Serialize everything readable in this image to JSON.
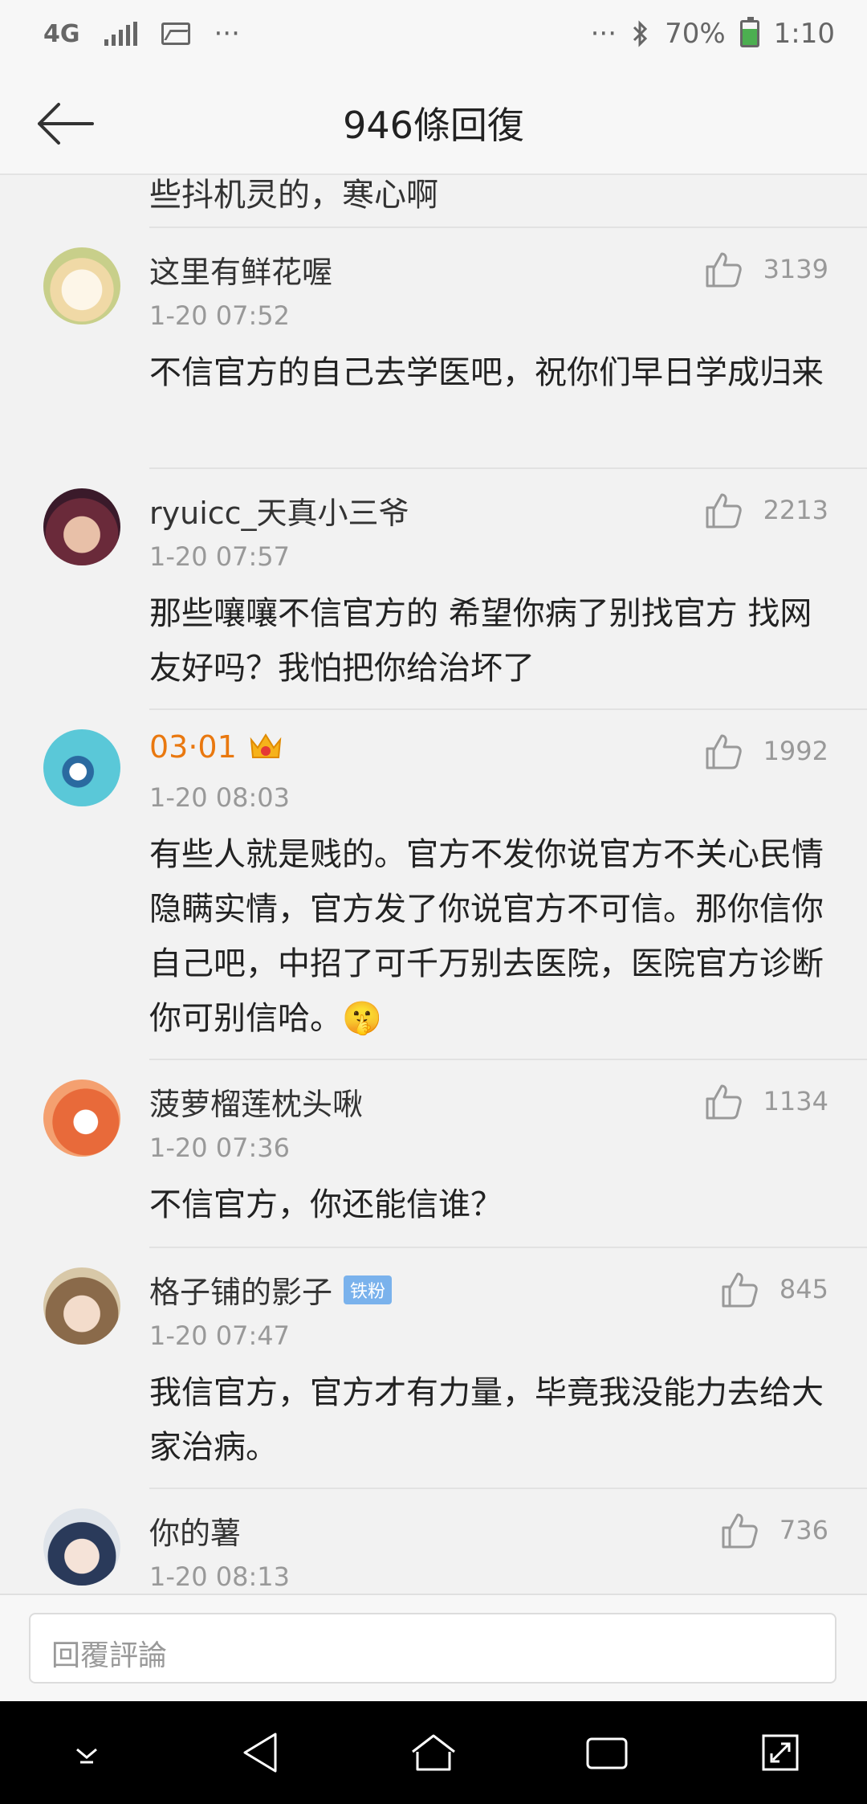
{
  "status_bar": {
    "network": "4G",
    "overflow": "···",
    "right_overflow": "···",
    "battery_percent": "70%",
    "time": "1:10"
  },
  "header": {
    "title": "946條回復",
    "back_icon": "arrow-left-icon"
  },
  "partial_comment_text": "些抖机灵的，寒心啊",
  "comments": [
    {
      "username": "这里有鲜花喔",
      "time": "1-20 07:52",
      "likes": "3139",
      "text": "不信官方的自己去学医吧，祝你们早日学成归来"
    },
    {
      "username": "ryuicc_天真小三爷",
      "time": "1-20 07:57",
      "likes": "2213",
      "text": "那些嚷嚷不信官方的 希望你病了别找官方 找网友好吗？我怕把你给治坏了"
    },
    {
      "username": "03·01",
      "time": "1-20 08:03",
      "likes": "1992",
      "text": "有些人就是贱的。官方不发你说官方不关心民情隐瞒实情，官方发了你说官方不可信。那你信你自己吧，中招了可千万别去医院，医院官方诊断你可别信哈。",
      "emoji": "🤫"
    },
    {
      "username": "菠萝榴莲枕头啾",
      "time": "1-20 07:36",
      "likes": "1134",
      "text": "不信官方，你还能信谁？"
    },
    {
      "username": "格子铺的影子",
      "badge": "铁粉",
      "time": "1-20 07:47",
      "likes": "845",
      "text": "我信官方，官方才有力量，毕竟我没能力去给大家治病。"
    },
    {
      "username": "你的薯",
      "time": "1-20 08:13",
      "likes": "736",
      "text": ""
    }
  ],
  "reply_bar": {
    "placeholder": "回覆評論"
  },
  "nav_bar": {
    "icons": [
      "chevron-down-icon",
      "back-triangle-icon",
      "home-icon",
      "recents-icon",
      "expand-icon"
    ]
  },
  "colors": {
    "vip_name": "#e9780f",
    "badge": "#7ab2ec",
    "background": "#f2f2f2"
  }
}
